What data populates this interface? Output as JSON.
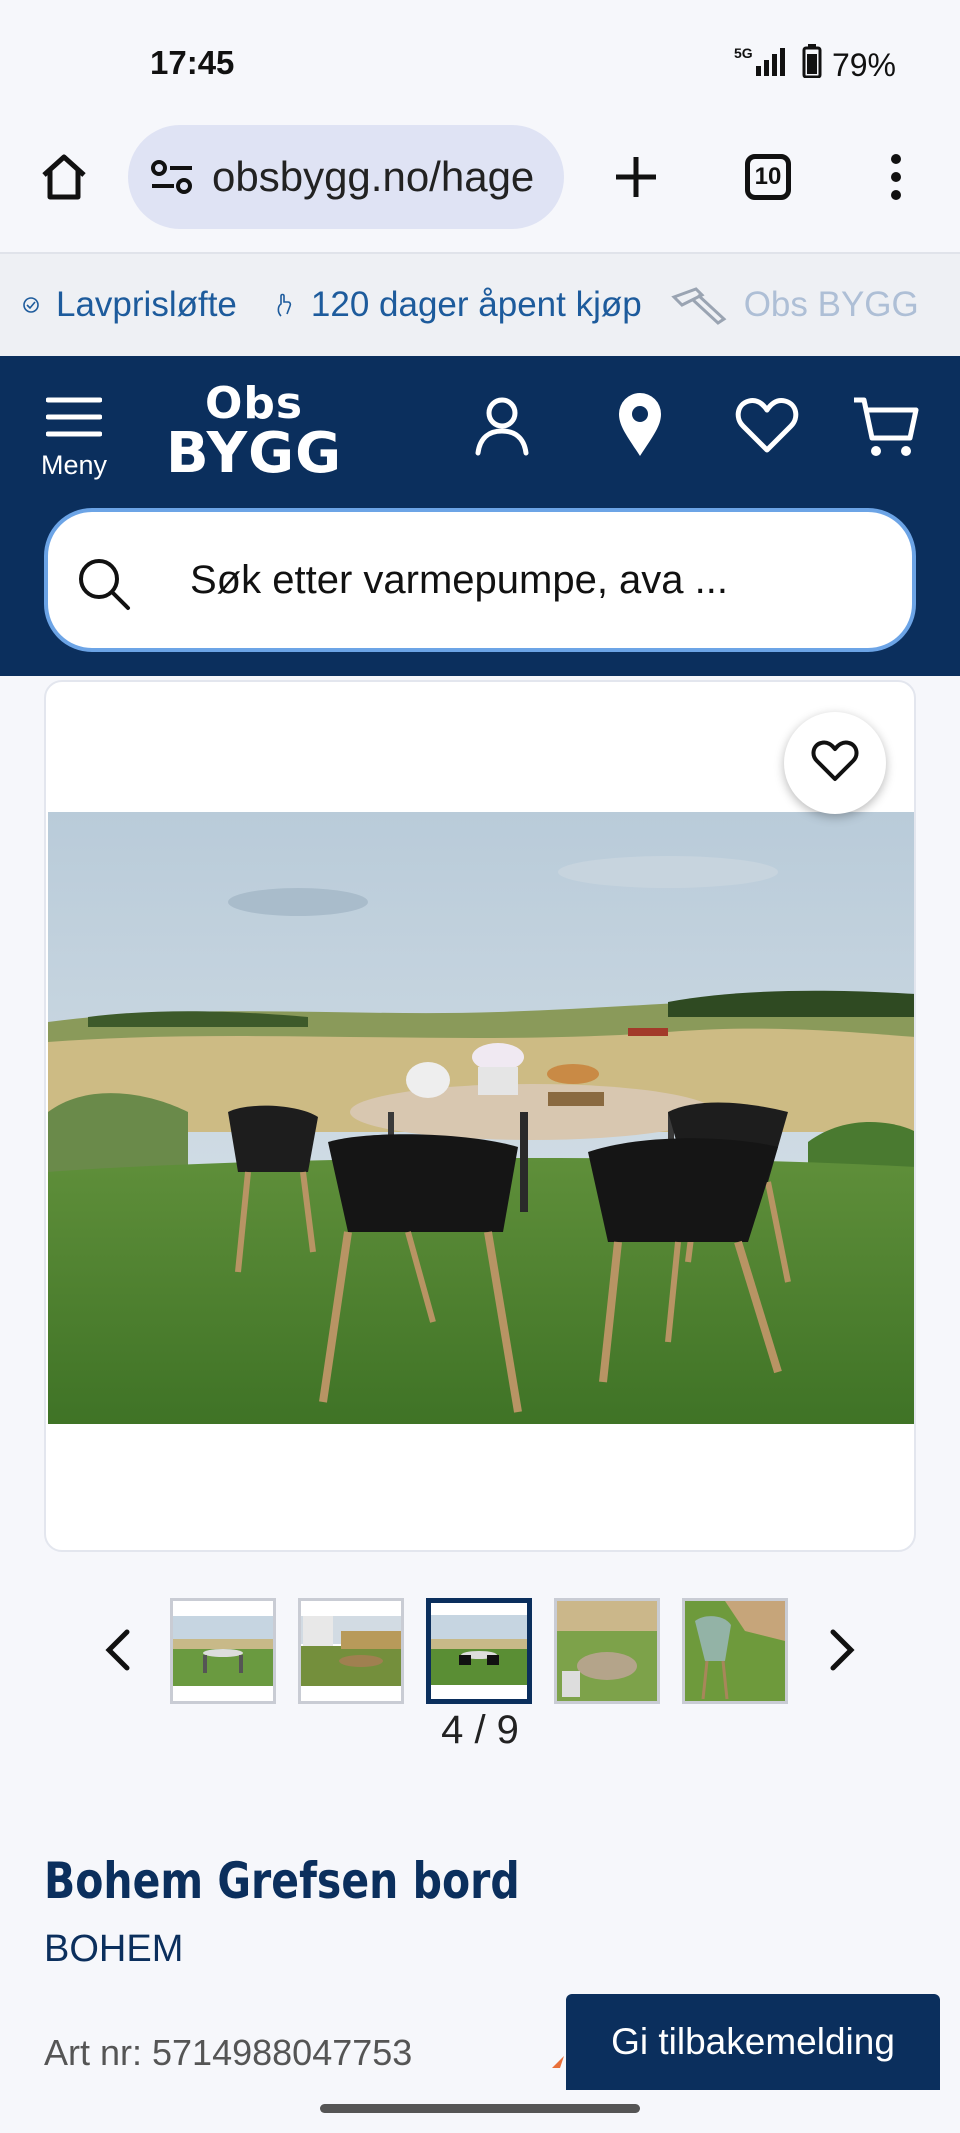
{
  "status_bar": {
    "time": "17:45",
    "network": "5G",
    "battery": "79%"
  },
  "browser": {
    "url": "obsbygg.no/hage",
    "tab_count": "10"
  },
  "promo": {
    "items": [
      {
        "label": "Lavprisløfte"
      },
      {
        "label": "120 dager åpent kjøp"
      },
      {
        "label": "Obs BYGG"
      }
    ]
  },
  "header": {
    "menu_label": "Meny",
    "logo_line1": "Obs",
    "logo_line2": "BYGG",
    "search_placeholder": "Søk etter varmepumpe, ava ..."
  },
  "gallery": {
    "current": "4",
    "total": "9",
    "pager_text": "4 / 9",
    "active_index": 3
  },
  "product": {
    "title": "Bohem Grefsen bord",
    "brand": "BOHEM",
    "art_nr": "Art nr: 5714988047753"
  },
  "feedback_button": "Gi tilbakemelding",
  "colors": {
    "brand_navy": "#0b2f5d",
    "promo_blue": "#1d5b9c",
    "search_border": "#6ca4e6"
  }
}
